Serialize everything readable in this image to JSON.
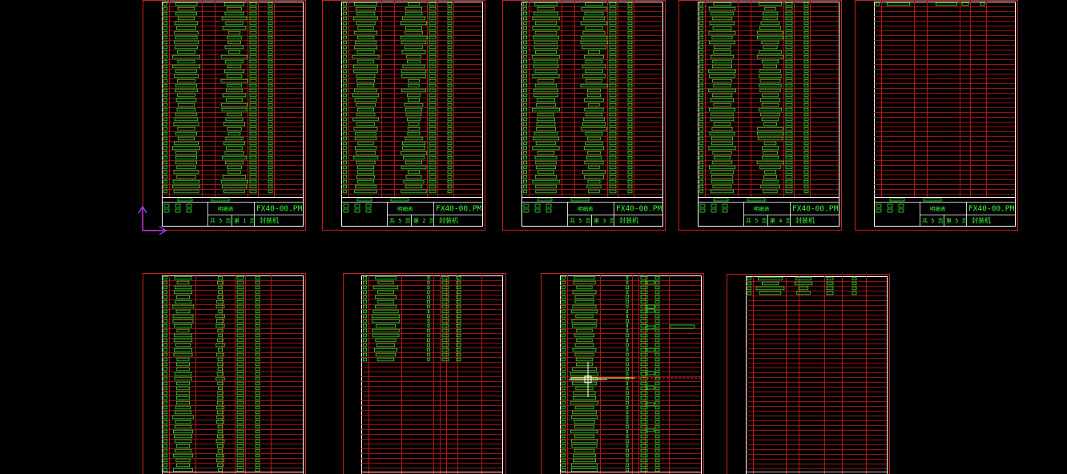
{
  "colors": {
    "background": "#000000",
    "sheet_border": "#cc1f1f",
    "grid_line": "#c81a1a",
    "entity": "#33ff33",
    "ucs_icon": "#b040ff",
    "highlight": "#ffd24a",
    "crosshair": "#ffffff"
  },
  "icons": {
    "ucs": "ucs-axis-icon",
    "crosshair": "crosshair-cursor-icon"
  },
  "sheets": [
    {
      "drawing_no": "FX40-00.PM",
      "stamp": "明细表",
      "total": "共 5 页",
      "page": "第 1 页",
      "name": "封装机",
      "has_titleblock": true,
      "fill": 1.0
    },
    {
      "drawing_no": "FX40-00.PM",
      "stamp": "明细表",
      "total": "共 5 页",
      "page": "第 2 页",
      "name": "封装机",
      "has_titleblock": true,
      "fill": 1.0
    },
    {
      "drawing_no": "FX40-00.PM",
      "stamp": "明细表",
      "total": "共 5 页",
      "page": "第 3 页",
      "name": "封装机",
      "has_titleblock": true,
      "fill": 1.0
    },
    {
      "drawing_no": "FX40-00.PM",
      "stamp": "明细表",
      "total": "共 5 页",
      "page": "第 4 页",
      "name": "封装机",
      "has_titleblock": true,
      "fill": 1.0
    },
    {
      "drawing_no": "FX40-00.PM",
      "stamp": "明细表",
      "total": "共 5 页",
      "page": "第 5 页",
      "name": "封装机",
      "has_titleblock": true,
      "fill": 0.02
    },
    {
      "has_titleblock": false,
      "fill": 1.0
    },
    {
      "has_titleblock": false,
      "fill": 0.45
    },
    {
      "has_titleblock": false,
      "fill": 1.0
    },
    {
      "has_titleblock": false,
      "fill": 0.1
    }
  ]
}
